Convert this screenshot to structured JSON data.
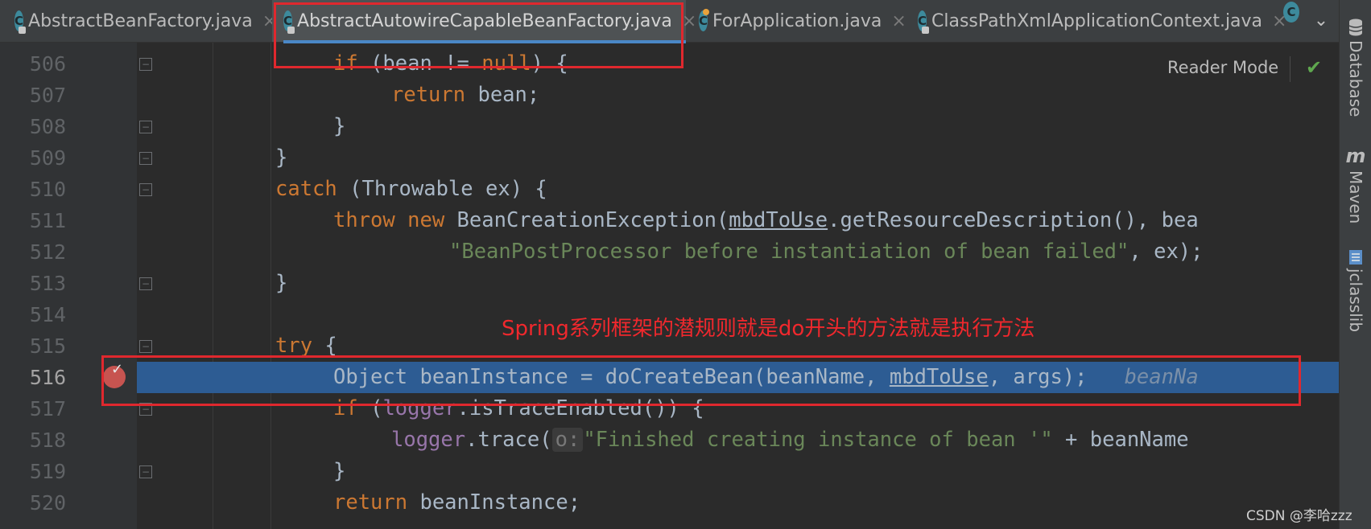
{
  "tabs": [
    {
      "label": "AbstractBeanFactory.java",
      "close": "×"
    },
    {
      "label": "AbstractAutowireCapableBeanFactory.java",
      "close": "×"
    },
    {
      "label": "ForApplication.java",
      "close": "×"
    },
    {
      "label": "ClassPathXmlApplicationContext.java",
      "close": "×"
    }
  ],
  "tab_icon_letter": "C",
  "tabs_chevron": "⌄",
  "right_tools": [
    {
      "label": "Database",
      "icon": "database-icon"
    },
    {
      "label": "Maven",
      "icon_text": "m"
    },
    {
      "label": "jclasslib",
      "icon": "jclasslib-icon"
    }
  ],
  "reader_mode": "Reader Mode",
  "line_numbers": [
    "506",
    "507",
    "508",
    "509",
    "510",
    "511",
    "512",
    "513",
    "514",
    "515",
    "516",
    "517",
    "518",
    "519",
    "520"
  ],
  "code": {
    "l506": {
      "kw": "if",
      "a": " (bean != ",
      "null": "null",
      "b": ") {"
    },
    "l507": {
      "kw": "return",
      "a": " bean;"
    },
    "l508": {
      "a": "}"
    },
    "l509": {
      "a": "}"
    },
    "l510": {
      "kw": "catch",
      "a": " (Throwable ex) {"
    },
    "l511": {
      "kw1": "throw",
      "kw2": "new",
      "a": " BeanCreationException(",
      "u": "mbdToUse",
      "b": ".getResourceDescription(), bea"
    },
    "l512": {
      "str": "\"BeanPostProcessor before instantiation of bean failed\"",
      "a": ", ex);"
    },
    "l513": {
      "a": "}"
    },
    "l515": {
      "kw": "try",
      "a": " {"
    },
    "l516": {
      "a": "Object beanInstance = doCreateBean(beanName, ",
      "u": "mbdToUse",
      "b": ", args);",
      "inlay": "beanNa"
    },
    "l517": {
      "kw": "if",
      "a": " (",
      "fld": "logger",
      "b": ".isTraceEnabled()) {"
    },
    "l518": {
      "fld": "logger",
      "a": ".trace(",
      "hint": "o:",
      "str": "\"Finished creating instance of bean '\"",
      "b": " + beanName"
    },
    "l519": {
      "a": "}"
    },
    "l520": {
      "kw": "return",
      "a": " beanInstance;"
    }
  },
  "annotation": "Spring系列框架的潜规则就是do开头的方法就是执行方法",
  "watermark": "CSDN @李哈zzz"
}
